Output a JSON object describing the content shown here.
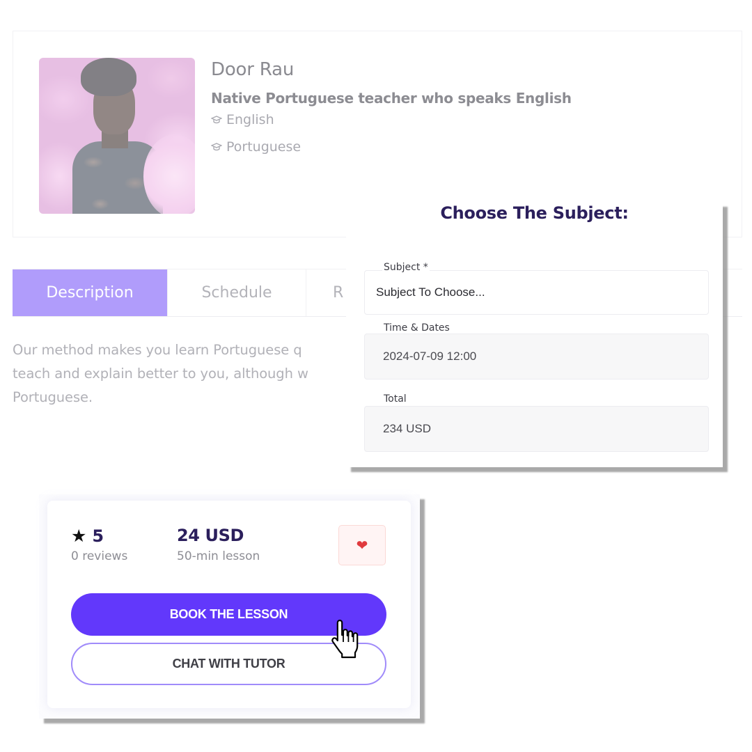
{
  "profile": {
    "name": "Door Rau",
    "headline": "Native Portuguese teacher who speaks English",
    "languages": [
      {
        "icon": "graduation-cap-icon",
        "label": "English"
      },
      {
        "icon": "graduation-cap-icon",
        "label": "Portuguese"
      }
    ]
  },
  "tabs": [
    {
      "label": "Description",
      "active": true
    },
    {
      "label": "Schedule",
      "active": false
    },
    {
      "label": "R",
      "active": false
    }
  ],
  "description": {
    "lines": [
      "Our method makes you learn Portuguese q",
      "teach and explain better to you, although w",
      "Portuguese."
    ]
  },
  "modal": {
    "title": "Choose The Subject:",
    "subject": {
      "label": "Subject *",
      "placeholder": "Subject To Choose..."
    },
    "time": {
      "label": "Time & Dates",
      "value": "2024-07-09 12:00"
    },
    "total": {
      "label": "Total",
      "value": "234 USD"
    }
  },
  "booking": {
    "rating": "5",
    "rating_icon": "star-icon",
    "reviews": "0 reviews",
    "price": "24 USD",
    "price_unit": "50-min lesson",
    "favorite_icon": "heart-icon",
    "book_label": "BOOK THE LESSON",
    "chat_label": "CHAT WITH TUTOR"
  },
  "colors": {
    "accent": "#6238fb",
    "tab_active": "#b09cfb",
    "title": "#2b1f5c",
    "heart": "#e03a3e"
  }
}
